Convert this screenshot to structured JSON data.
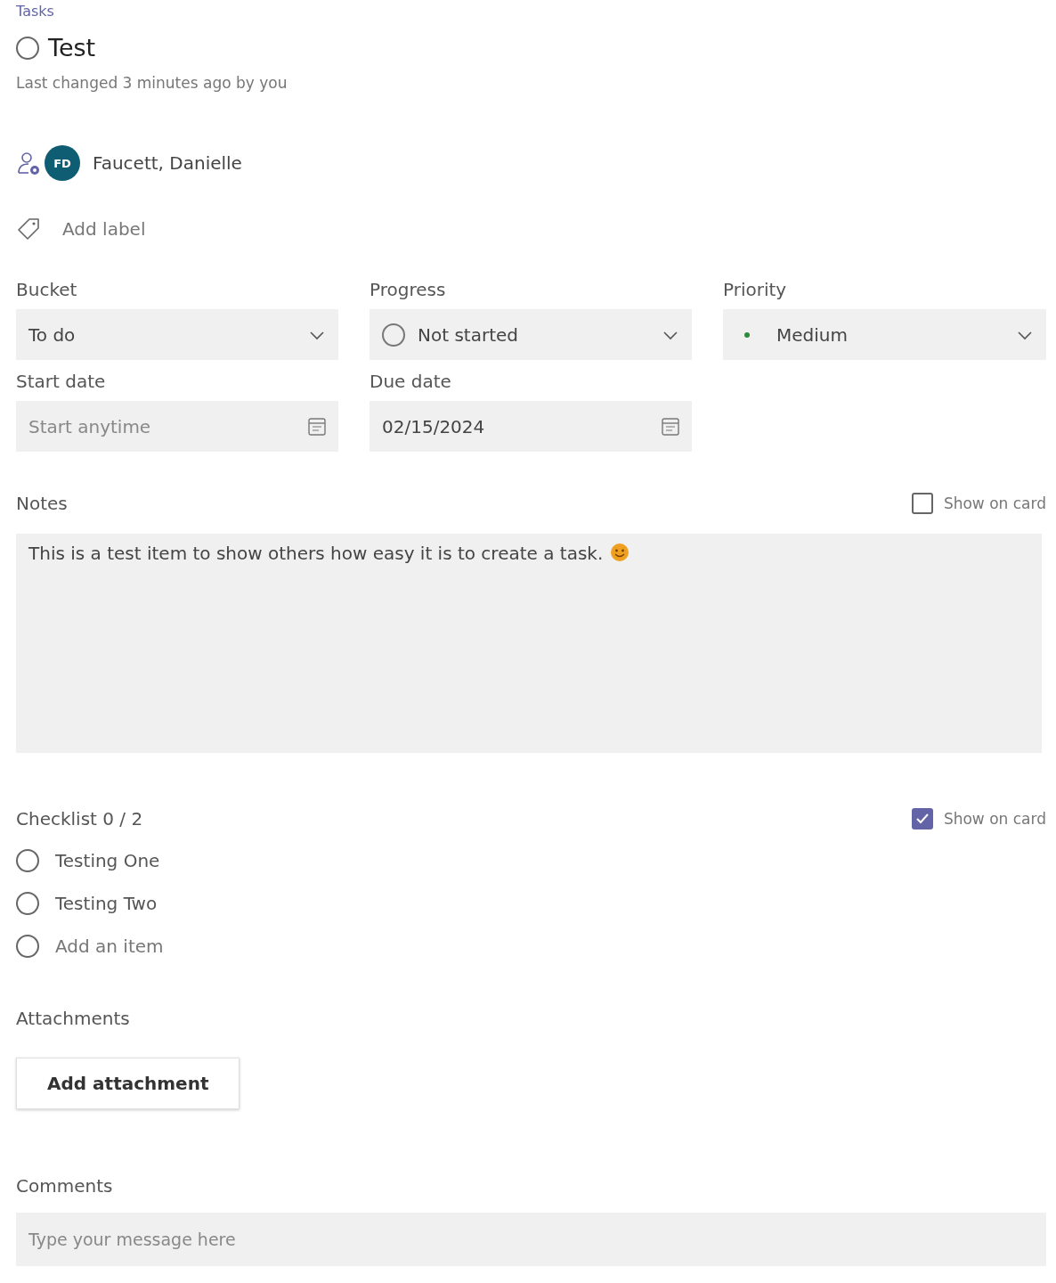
{
  "breadcrumb": "Tasks",
  "task": {
    "title": "Test",
    "completed": false,
    "last_changed": "Last changed 3 minutes ago by you"
  },
  "assignees": [
    {
      "initials": "FD",
      "name": "Faucett, Danielle",
      "color": "#0f5d73"
    }
  ],
  "label": {
    "placeholder": "Add label"
  },
  "fields": [
    {
      "kind": "dropdown",
      "label": "Bucket",
      "value": "To do"
    },
    {
      "kind": "progress",
      "label": "Progress",
      "value": "Not started"
    },
    {
      "kind": "priority",
      "label": "Priority",
      "value": "Medium",
      "color": "#2e8b3a"
    },
    {
      "kind": "date",
      "label": "Start date",
      "placeholder": "Start anytime"
    },
    {
      "kind": "date",
      "label": "Due date",
      "value": "02/15/2024"
    }
  ],
  "notes": {
    "label": "Notes",
    "show_on_card": {
      "label": "Show on card",
      "checked": false
    },
    "text": "This is a test item to show others how easy it is to create a task.",
    "emoji": true
  },
  "checklist": {
    "title": "Checklist 0 / 2",
    "show_on_card": {
      "label": "Show on card",
      "checked": true
    },
    "items": [
      {
        "kind": "item",
        "text": "Testing One",
        "checked": false
      },
      {
        "kind": "item",
        "text": "Testing Two",
        "checked": false
      },
      {
        "kind": "add",
        "placeholder": "Add an item",
        "checked": false
      }
    ]
  },
  "attachments": {
    "label": "Attachments",
    "button": "Add attachment"
  },
  "comments": {
    "label": "Comments",
    "placeholder": "Type your message here"
  }
}
